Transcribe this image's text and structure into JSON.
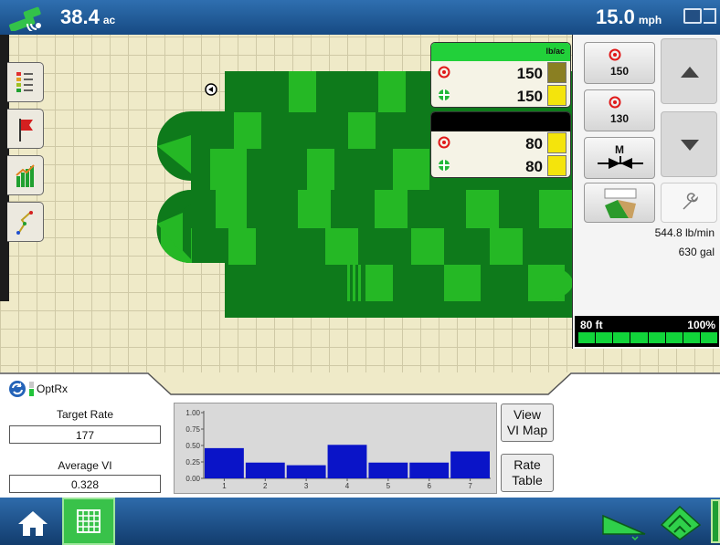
{
  "topbar": {
    "area_value": "38.4",
    "area_unit": "ac",
    "speed_value": "15.0",
    "speed_unit": "mph"
  },
  "rate_panel_1": {
    "unit": "lb/ac",
    "target": "150",
    "actual": "150",
    "header_color": "#22d03a"
  },
  "rate_panel_2": {
    "target": "80",
    "actual": "80",
    "header_color": "#000000"
  },
  "right_panel": {
    "preset_1": "150",
    "preset_2": "130",
    "manual_label": "M",
    "flow_rate": "544.8 lb/min",
    "volume": "630 gal",
    "boom_width": "80 ft",
    "boom_percent": "100%",
    "boom_sections": 8
  },
  "optrx": {
    "title": "OptRx",
    "target_rate_label": "Target Rate",
    "target_rate_value": "177",
    "average_vi_label": "Average VI",
    "average_vi_value": "0.328",
    "view_vi_map_label_1": "View",
    "view_vi_map_label_2": "VI Map",
    "rate_table_label_1": "Rate",
    "rate_table_label_2": "Table"
  },
  "chart_data": {
    "type": "bar",
    "categories": [
      "1",
      "2",
      "3",
      "4",
      "5",
      "6",
      "7"
    ],
    "values": [
      0.46,
      0.24,
      0.2,
      0.51,
      0.24,
      0.24,
      0.41
    ],
    "ylim": [
      0,
      1
    ],
    "yticks": [
      "0.00",
      "0.25",
      "0.50",
      "0.75",
      "1.00"
    ],
    "xlabel": "",
    "ylabel": "",
    "bar_color": "#0a14c8",
    "grid": false
  },
  "colors": {
    "field_dark": "#0e7a1b",
    "field_light": "#25b825",
    "map_bg": "#efeac8",
    "accent_green": "#22d03a"
  },
  "icons": {
    "gps": "gps-satellite-icon",
    "map_view": "map-display-icon",
    "home": "home-icon",
    "grid": "grid-icon",
    "swath": "swath-icon",
    "layers": "layers-icon"
  }
}
